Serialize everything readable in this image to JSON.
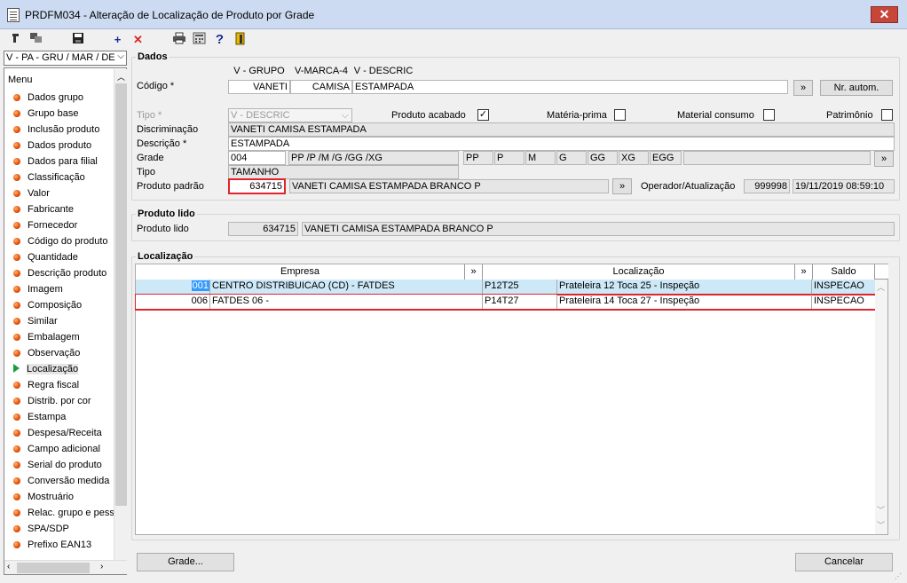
{
  "window": {
    "title": "PRDFM034 - Alteração de Localização de Produto por Grade",
    "close": "✕"
  },
  "toolbar": {
    "add": "+",
    "delete": "✕",
    "help": "?"
  },
  "sidebar": {
    "combo_value": "V - PA - GRU / MAR / DE",
    "header": "Menu",
    "items": [
      "Dados grupo",
      "Grupo base",
      "Inclusão produto",
      "Dados produto",
      "Dados para filial",
      "Classificação",
      "Valor",
      "Fabricante",
      "Fornecedor",
      "Código do produto",
      "Quantidade",
      "Descrição produto",
      "Imagem",
      "Composição",
      "Similar",
      "Embalagem",
      "Observação",
      "Localização",
      "Regra fiscal",
      "Distrib. por cor",
      "Estampa",
      "Despesa/Receita",
      "Campo adicional",
      "Serial do produto",
      "Conversão medida",
      "Mostruário",
      "Relac. grupo e pess",
      "SPA/SDP",
      "Prefixo EAN13"
    ],
    "selected": "Localização"
  },
  "dados": {
    "title": "Dados",
    "codigo_label": "Código *",
    "codigo_headers": [
      "V - GRUPO",
      "V-MARCA-4",
      "V - DESCRIC"
    ],
    "codigo_values": [
      "VANETI",
      "CAMISA",
      "ESTAMPADA"
    ],
    "more_btn": "»",
    "nr_autom_btn": "Nr. autom.",
    "tipo_label": "Tipo *",
    "tipo_value": "V - DESCRIC",
    "produto_acabado_label": "Produto acabado",
    "produto_acabado_checked": "✓",
    "materia_prima_label": "Matéria-prima",
    "material_consumo_label": "Material consumo",
    "patrimonio_label": "Patrimônio",
    "discriminacao_label": "Discriminação",
    "discriminacao_value": "VANETI CAMISA ESTAMPADA",
    "descricao_label": "Descrição *",
    "descricao_value": "ESTAMPADA",
    "grade_label": "Grade",
    "grade_code": "004",
    "grade_desc": "PP /P /M /G /GG /XG",
    "grade_sizes": [
      "PP",
      "P",
      "M",
      "G",
      "GG",
      "XG",
      "EGG"
    ],
    "tipo2_label": "Tipo",
    "tipo2_value": "TAMANHO",
    "produto_padrao_label": "Produto padrão",
    "produto_padrao_code": "634715",
    "produto_padrao_desc": "VANETI CAMISA ESTAMPADA BRANCO P",
    "operador_label": "Operador/Atualização",
    "operador_code": "999998",
    "operador_date": "19/11/2019 08:59:10"
  },
  "produto_lido": {
    "title": "Produto lido",
    "label": "Produto lido",
    "code": "634715",
    "desc": "VANETI CAMISA ESTAMPADA BRANCO P"
  },
  "localizacao": {
    "title": "Localização",
    "columns": [
      "Empresa",
      "»",
      "Localização",
      "»",
      "Saldo"
    ],
    "rows": [
      {
        "code": "001",
        "empresa": "CENTRO DISTRIBUICAO (CD) - FATDES",
        "loc_code": "P12T25",
        "loc_desc": "Prateleira 12 Toca 25 - Inspeção",
        "saldo": "INSPECAO"
      },
      {
        "code": "006",
        "empresa": "FATDES 06 -",
        "loc_code": "P14T27",
        "loc_desc": "Prateleira 14 Toca 27 - Inspeção",
        "saldo": "INSPECAO"
      }
    ]
  },
  "footer": {
    "grade_btn": "Grade...",
    "cancelar_btn": "Cancelar"
  },
  "colors": {
    "titlebar": "#ccdbf1",
    "highlight": "#e0242c",
    "row_selected": "#cde8f7"
  }
}
